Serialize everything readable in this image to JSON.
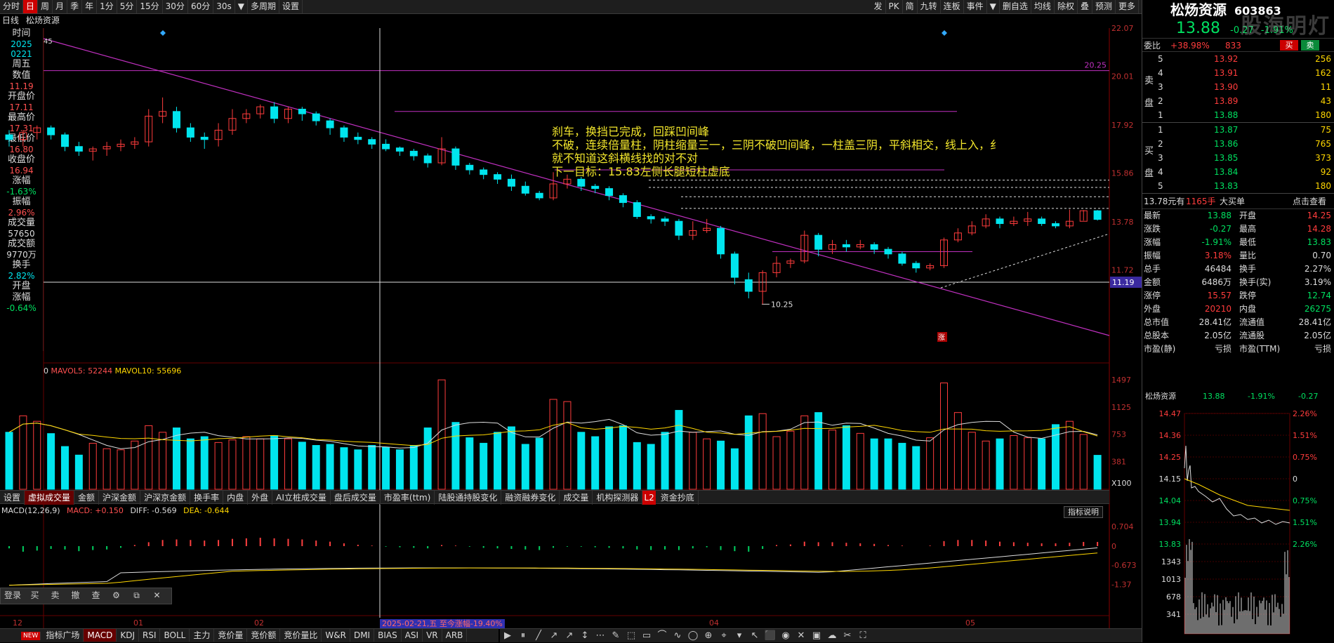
{
  "toolbar": {
    "left": [
      "分时",
      "日",
      "周",
      "月",
      "季",
      "年",
      "1分",
      "5分",
      "15分",
      "30分",
      "60分",
      "30s",
      "▼",
      "多周期",
      "设置"
    ],
    "right": [
      "发",
      "PK",
      "简",
      "九转",
      "连板",
      "事件",
      "▼",
      "删自选",
      "均线",
      "除权",
      "叠",
      "预测",
      "更多"
    ]
  },
  "title_bar": {
    "period": "日线",
    "name": "松炀资源"
  },
  "info_panel": [
    {
      "label": "时间",
      "value": "2025"
    },
    {
      "label": "",
      "value": "0221"
    },
    {
      "label": "周五",
      "value": ""
    },
    {
      "label": "数值",
      "value": "11.19"
    },
    {
      "label": "开盘价",
      "value": "17.11"
    },
    {
      "label": "最高价",
      "value": "17.31"
    },
    {
      "label": "最低价",
      "value": "16.80"
    },
    {
      "label": "收盘价",
      "value": "16.94"
    },
    {
      "label": "涨幅",
      "value": "-1.63%"
    },
    {
      "label": "振幅",
      "value": "2.96%"
    },
    {
      "label": "成交量",
      "value": "57650"
    },
    {
      "label": "成交额",
      "value": "9770万"
    },
    {
      "label": "换手",
      "value": "2.82%"
    },
    {
      "label": "开盘",
      "value": ""
    },
    {
      "label": "涨幅",
      "value": "-0.64%"
    }
  ],
  "price_axis": [
    "22.07",
    "20.01",
    "17.92",
    "15.86",
    "13.78",
    "11.72"
  ],
  "price_labels": {
    "line_2025": "20.25",
    "current": "11.19",
    "low": "10.25",
    "top_left": "45",
    "zhang": "涨"
  },
  "annotation": [
    "刹车，换挡已完成，回踩凹间峰",
    "不破，连续倍量柱，阴柱缩量三一，三阴不破凹间峰，一柱盖三阴，平斜相交，线上入，纟",
    "就不知道这斜横线找的对不对",
    "下一目标：15.83左侧长腿短柱虚底"
  ],
  "volume": {
    "header_prefix": "0",
    "mavol5_label": "MAVOL5: 52244",
    "mavol10_label": "MAVOL10: 55696",
    "axis": [
      "1497",
      "1125",
      "753",
      "381",
      "X100"
    ]
  },
  "indicator_tabs": [
    "设置",
    "虚拟成交量",
    "金额",
    "沪深金额",
    "沪深京金额",
    "换手率",
    "内盘",
    "外盘",
    "AI立桩成交量",
    "盘后成交量",
    "市盈率(ttm)",
    "陆股通持股变化",
    "融资融券变化",
    "成交量",
    "机构探测器",
    "资金抄底"
  ],
  "indicator_tab_l2": "L2",
  "macd": {
    "title": "MACD(12,26,9)",
    "macd": "MACD: +0.150",
    "diff": "DIFF: -0.569",
    "dea": "DEA: -0.644",
    "help": "指标说明",
    "axis": [
      "0.704",
      "0",
      "-0.673",
      "-1.37"
    ]
  },
  "date_axis": [
    "12",
    "01",
    "02",
    "03",
    "04",
    "05"
  ],
  "date_tooltip": "2025-02-21,五 至今涨幅-19.40%",
  "float_toolbar": [
    "登录",
    "买",
    "卖",
    "撤",
    "查",
    "⚙",
    "⧉",
    "✕"
  ],
  "bottom_tabs": [
    "NEW",
    "指标广场",
    "MACD",
    "KDJ",
    "RSI",
    "BOLL",
    "主力",
    "竞价量",
    "竞价额",
    "竞价量比",
    "W&R",
    "DMI",
    "BIAS",
    "ASI",
    "VR",
    "ARB"
  ],
  "right_panel": {
    "name": "松炀资源",
    "code": "603863",
    "price": "13.88",
    "change": "-0.27",
    "pct": "-1.91%",
    "weibi_label": "委比",
    "weibi": "+38.98%",
    "weicha": "833",
    "buy_btn": "买",
    "sell_btn": "卖",
    "sell_label": [
      "卖",
      "盘"
    ],
    "buy_label": [
      "买",
      "盘"
    ],
    "asks": [
      [
        "5",
        "13.92",
        "256"
      ],
      [
        "4",
        "13.91",
        "162"
      ],
      [
        "3",
        "13.90",
        "11"
      ],
      [
        "2",
        "13.89",
        "43"
      ],
      [
        "1",
        "13.88",
        "180"
      ]
    ],
    "bids": [
      [
        "1",
        "13.87",
        "75"
      ],
      [
        "2",
        "13.86",
        "765"
      ],
      [
        "3",
        "13.85",
        "373"
      ],
      [
        "4",
        "13.84",
        "92"
      ],
      [
        "5",
        "13.83",
        "180"
      ]
    ],
    "big_order": {
      "price": "13.78元有",
      "vol": "1165手",
      "type": "大买单",
      "link": "点击查看"
    },
    "stats": [
      [
        "最新",
        "13.88",
        "开盘",
        "14.25"
      ],
      [
        "涨跌",
        "-0.27",
        "最高",
        "14.28"
      ],
      [
        "涨幅",
        "-1.91%",
        "最低",
        "13.83"
      ],
      [
        "振幅",
        "3.18%",
        "量比",
        "0.70"
      ],
      [
        "总手",
        "46484",
        "换手",
        "2.27%"
      ],
      [
        "金额",
        "6486万",
        "换手(实)",
        "3.19%"
      ],
      [
        "涨停",
        "15.57",
        "跌停",
        "12.74"
      ],
      [
        "外盘",
        "20210",
        "内盘",
        "26275"
      ],
      [
        "总市值",
        "28.41亿",
        "流通值",
        "28.41亿"
      ],
      [
        "总股本",
        "2.05亿",
        "流通股",
        "2.05亿"
      ],
      [
        "市盈(静)",
        "亏损",
        "市盈(TTM)",
        "亏损"
      ]
    ],
    "mini": {
      "name": "松炀资源",
      "price": "13.88",
      "pct": "-1.91%",
      "chg": "-0.27",
      "left_axis": [
        "14.47",
        "14.36",
        "14.25",
        "14.15",
        "14.04",
        "13.94",
        "13.83",
        "1343",
        "1013",
        "678",
        "341"
      ],
      "right_axis": [
        "2.26%",
        "1.51%",
        "0.75%",
        "0",
        "0.75%",
        "1.51%",
        "2.26%"
      ]
    }
  },
  "watermark": "股海明灯"
}
